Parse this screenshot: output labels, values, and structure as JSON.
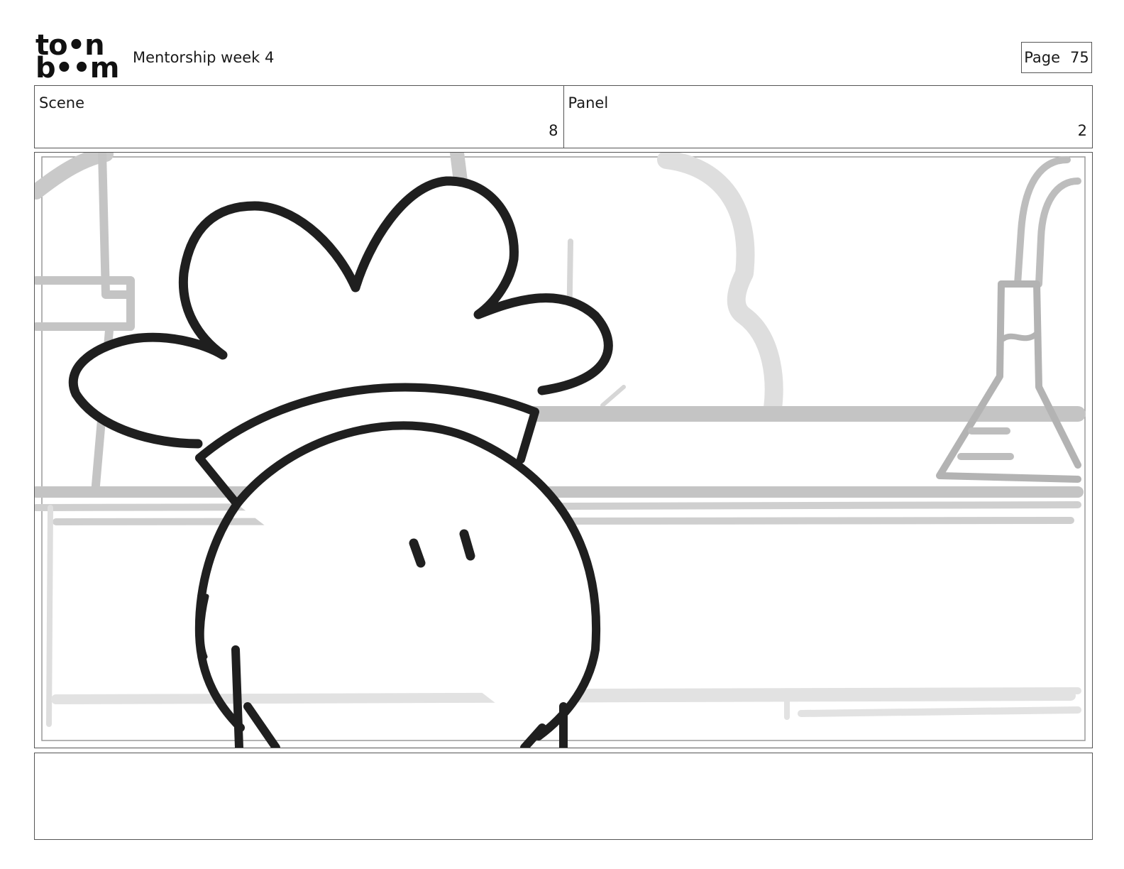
{
  "header": {
    "logo": {
      "line1": "to•n",
      "line2": "b••m"
    },
    "project_title": "Mentorship week 4",
    "page_label": "Page",
    "page_number": "75"
  },
  "info": {
    "scene_label": "Scene",
    "scene_value": "8",
    "panel_label": "Panel",
    "panel_value": "2"
  },
  "panel": {
    "subject": "cartoon-chef-character",
    "background": "laboratory-shelves-sketch",
    "colors": {
      "ink": "#1f1f1f",
      "background_sketch": "#bdbdbd",
      "background_light": "#d9d9d9",
      "paper": "#ffffff"
    }
  },
  "caption": {
    "text": ""
  }
}
